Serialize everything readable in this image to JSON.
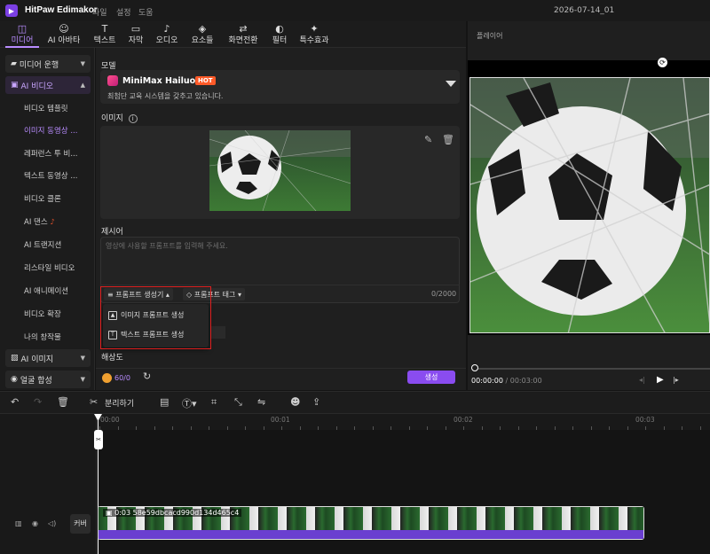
{
  "app": {
    "title": "HitPaw Edimakor",
    "logo_glyph": "▶",
    "menu": [
      "파일",
      "설정",
      "도움"
    ],
    "project": "2026-07-14_01"
  },
  "top_tabs": [
    {
      "label": "미디어",
      "icon": "media-icon",
      "active": true
    },
    {
      "label": "AI 아바타",
      "icon": "avatar-icon"
    },
    {
      "label": "텍스트",
      "icon": "text-icon"
    },
    {
      "label": "자막",
      "icon": "subtitle-icon"
    },
    {
      "label": "오디오",
      "icon": "audio-icon"
    },
    {
      "label": "요소들",
      "icon": "elements-icon"
    },
    {
      "label": "화면전환",
      "icon": "transition-icon"
    },
    {
      "label": "필터",
      "icon": "filter-icon"
    },
    {
      "label": "특수효과",
      "icon": "effects-icon"
    }
  ],
  "sidebar": {
    "groups": {
      "media": "미디어 운행",
      "ai_video": "AI 비디오",
      "ai_image": "AI 이미지",
      "face": "얼굴 합성"
    },
    "items": [
      "비디오 템플릿",
      "이미지 동영상 ...",
      "레퍼런스 투 비...",
      "텍스트 동영상 ...",
      "비디오 클론",
      "AI 댄스",
      "AI 트랜지션",
      "리스타일 비디오",
      "AI 애니메이션",
      "비디오 확장",
      "나의 창작물"
    ],
    "active_index": 1
  },
  "panel": {
    "model_label": "모델",
    "model": {
      "name": "MiniMax Hailuo 02",
      "badge": "HOT",
      "desc": "최첨단 교육 시스템을 갖추고 있습니다."
    },
    "image_label": "이미지",
    "prompt_label": "제시어",
    "prompt": {
      "placeholder": "영상에 사용할 프롬프트를 입력해 주세요.",
      "count": "0/2000"
    },
    "prompt_tools": {
      "generator": "프롬프트 생성기",
      "tags": "프롬프트 태그"
    },
    "popup": {
      "image_prompt": "이미지 프롬프트 생성",
      "text_prompt": "텍스트 프롬프트 생성"
    },
    "resolution_label": "해상도",
    "credits": "60/0",
    "generate": "생성"
  },
  "player": {
    "title": "플레이어",
    "time_current": "00:00:00",
    "time_total": "/ 00:03:00"
  },
  "timeline": {
    "split_label": "분리하기",
    "ruler": [
      "00:00",
      "00:01",
      "00:02",
      "00:03"
    ],
    "clip_label": "0:03 58e59dbcacd990d134d465c4",
    "cover": "커버"
  },
  "colors": {
    "accent": "#b98cff",
    "primary_button": "#8a4cf0",
    "hot": "#ff5a28",
    "highlight_frame": "#e02020"
  }
}
